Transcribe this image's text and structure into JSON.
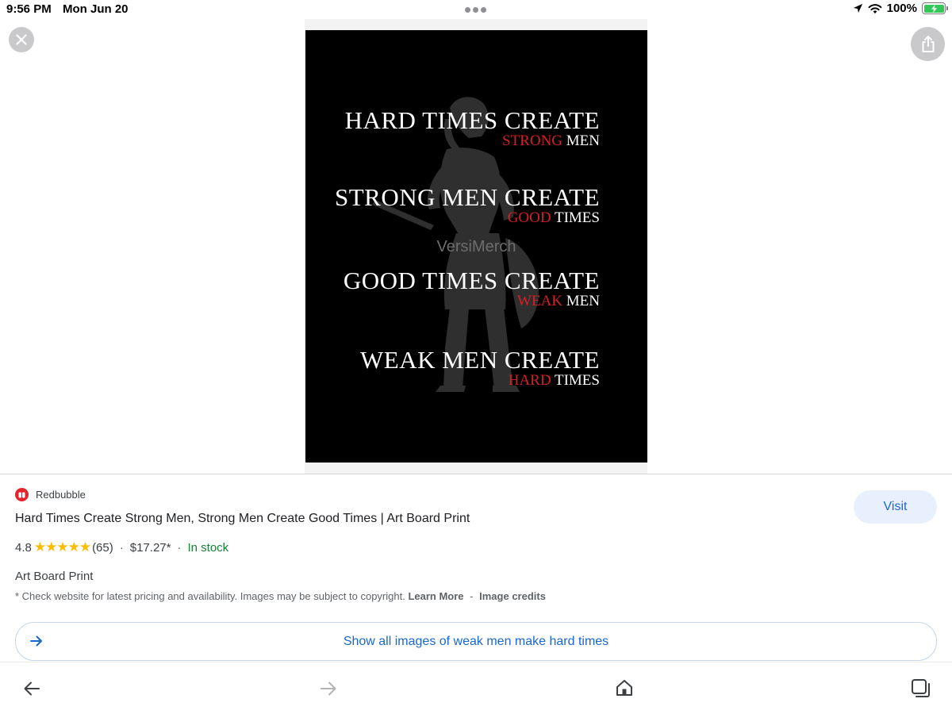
{
  "status_bar": {
    "time": "9:56 PM",
    "date": "Mon Jun 20",
    "battery": "100%",
    "battery_color": "#34c759"
  },
  "poster": {
    "blocks": [
      {
        "line1": "HARD  TIMES CREATE",
        "red": "STRONG",
        "rest": " MEN"
      },
      {
        "line1": "STRONG MEN CREATE",
        "red": "GOOD",
        "rest": " TIMES"
      },
      {
        "line1": "GOOD TIMES CREATE",
        "red": "WEAK",
        "rest": " MEN"
      },
      {
        "line1": "WEAK MEN CREATE",
        "red": "HARD",
        "rest": " TIMES"
      }
    ],
    "watermark": "VersiMerch",
    "accent_color": "#d51f26"
  },
  "listing": {
    "source": "Redbubble",
    "title": "Hard Times Create Strong Men, Strong Men Create Good Times | Art Board Print",
    "rating": "4.8",
    "stars": "★★★★★",
    "reviews": "(65)",
    "sep": "·",
    "price": "$17.27*",
    "availability": "In stock",
    "visit_label": "Visit",
    "product_type": "Art Board Print",
    "disclaimer": "* Check website for latest pricing and availability. Images may be subject to copyright.",
    "learn_more": "Learn More",
    "dash": "-",
    "image_credits": "Image credits",
    "show_all": "Show all images of weak men make hard times"
  },
  "icons": {
    "close": "close-icon",
    "share": "share-icon",
    "back": "back-arrow-icon",
    "forward": "forward-arrow-icon",
    "home": "home-icon",
    "tabs": "tabs-icon",
    "location": "location-arrow-icon",
    "wifi": "wifi-icon"
  }
}
